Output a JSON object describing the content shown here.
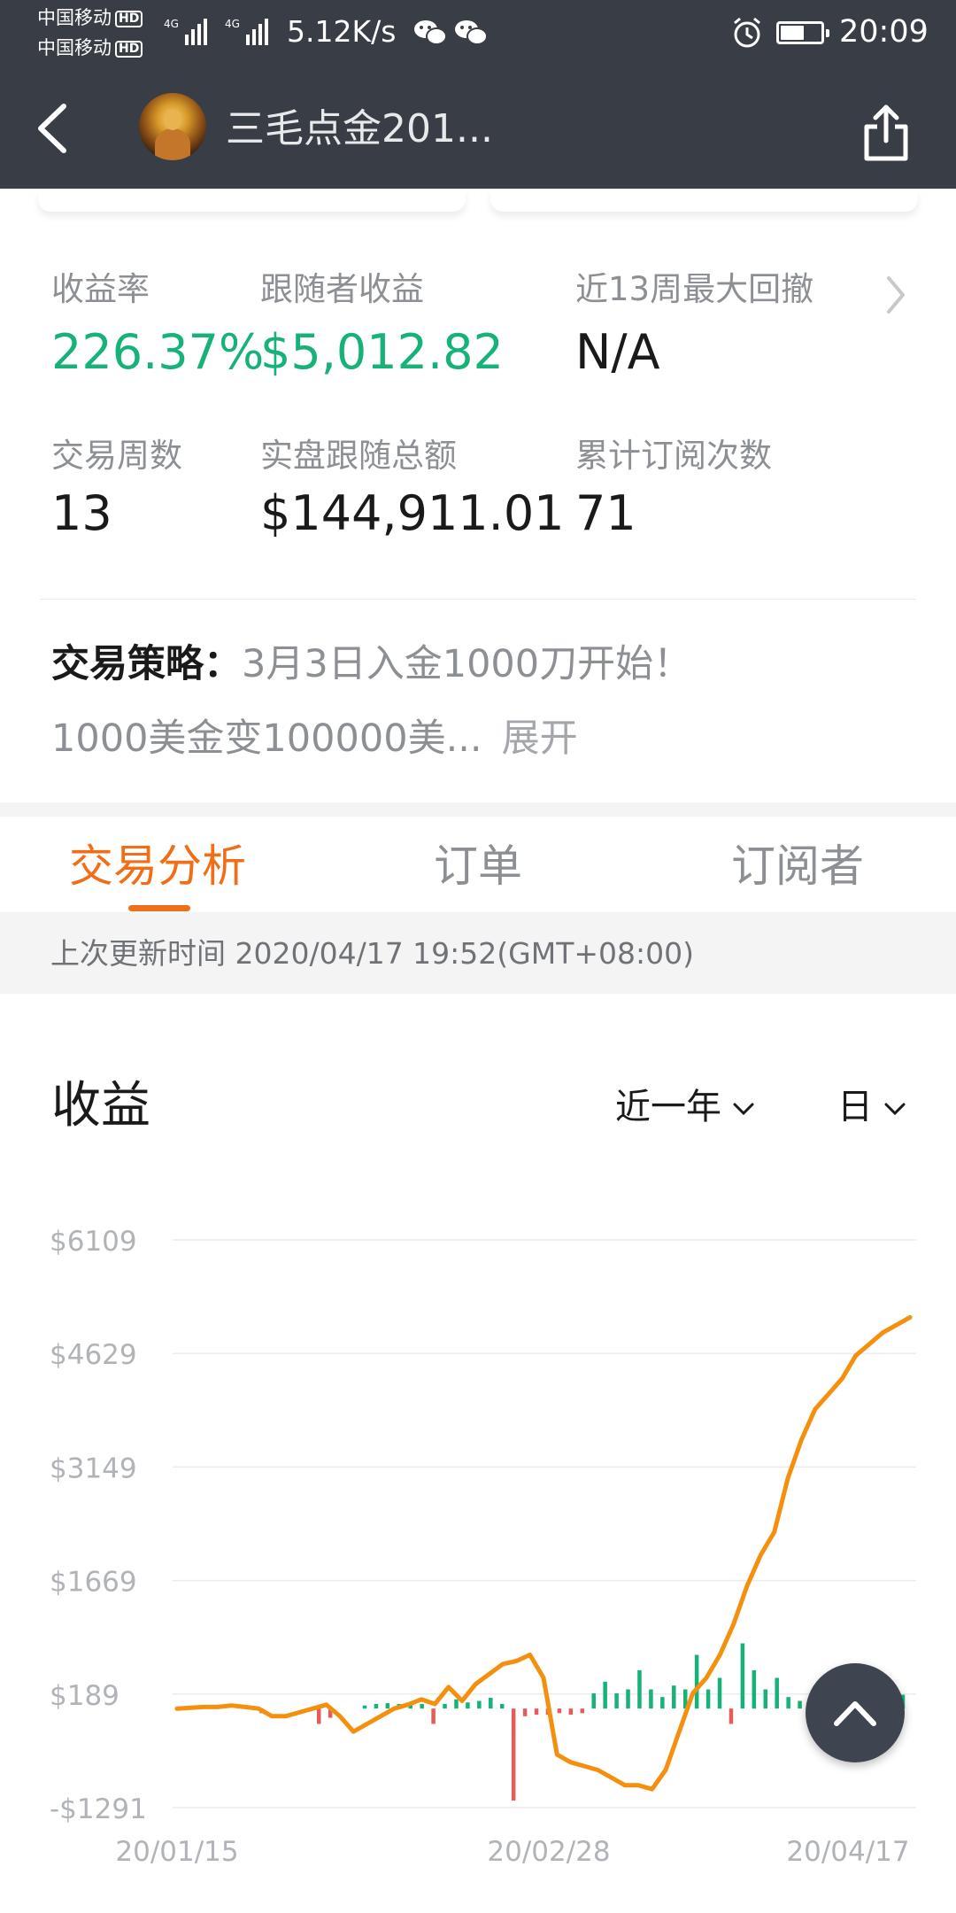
{
  "status_bar": {
    "carrier_1": "中国移动",
    "carrier_2": "中国移动",
    "hd_badge": "HD",
    "net_type": "4G",
    "speed": "5.12K/s",
    "time": "20:09",
    "battery_level": 0.5
  },
  "header": {
    "title": "三毛点金201...",
    "back_icon": "chevron-left-icon",
    "share_icon": "share-icon"
  },
  "stats": [
    {
      "label": "收益率",
      "value": "226.37%",
      "color": "#16b277"
    },
    {
      "label": "跟随者收益",
      "value": "$5,012.82",
      "color": "#16b277"
    },
    {
      "label": "近13周最大回撤",
      "value": "N/A"
    },
    {
      "label": "交易周数",
      "value": "13"
    },
    {
      "label": "实盘跟随总额",
      "value": "$144,911.01"
    },
    {
      "label": "累计订阅次数",
      "value": "71"
    }
  ],
  "strategy": {
    "label": "交易策略：",
    "line1": "3月3日入金1000刀开始！",
    "line2": "1000美金变100000美...",
    "expand": "展开"
  },
  "tabs": [
    {
      "label": "交易分析",
      "active": true
    },
    {
      "label": "订单",
      "active": false
    },
    {
      "label": "订阅者",
      "active": false
    }
  ],
  "update_text": "上次更新时间 2020/04/17 19:52(GMT+08:00)",
  "section": {
    "title": "收益",
    "period_filter": "近一年",
    "interval_filter": "日"
  },
  "colors": {
    "accent": "#f16e16",
    "positive": "#16b277",
    "negative": "#e55c5c",
    "line": "#f5900f",
    "header_bg": "#393e46"
  },
  "chart_data": {
    "type": "line",
    "title": "收益",
    "y_ticks": [
      "$6109",
      "$4629",
      "$3149",
      "$1669",
      "$189",
      "-$1291"
    ],
    "ylim": [
      -1291,
      6109
    ],
    "x_ticks": [
      "20/01/15",
      "20/02/28",
      "20/04/17"
    ],
    "grid": true,
    "series": [
      {
        "type": "line",
        "color": "#f5900f",
        "values": [
          0,
          10,
          20,
          20,
          40,
          20,
          0,
          -100,
          -100,
          -50,
          0,
          50,
          -100,
          -300,
          -200,
          -100,
          0,
          50,
          120,
          60,
          280,
          100,
          320,
          450,
          580,
          620,
          700,
          400,
          -600,
          -700,
          -750,
          -800,
          -900,
          -1000,
          -1000,
          -1050,
          -800,
          -300,
          200,
          400,
          700,
          1100,
          1600,
          2000,
          2300,
          3000,
          3500,
          3900,
          4100,
          4300,
          4600,
          4750,
          4900,
          5000,
          5100
        ]
      },
      {
        "type": "bar",
        "color_positive": "#16b277",
        "color_negative": "#e55c5c",
        "values": [
          0,
          0,
          0,
          0,
          0,
          0,
          0,
          -60,
          0,
          0,
          0,
          0,
          -200,
          -120,
          0,
          0,
          40,
          60,
          70,
          60,
          80,
          60,
          -200,
          60,
          120,
          80,
          100,
          140,
          60,
          -1200,
          -100,
          -80,
          -80,
          -60,
          -80,
          -60,
          200,
          350,
          200,
          250,
          500,
          250,
          150,
          300,
          250,
          700,
          250,
          400,
          -200,
          850,
          500,
          250,
          400,
          150,
          100,
          80,
          100,
          200,
          80,
          100,
          150,
          70,
          100,
          180
        ]
      }
    ]
  }
}
